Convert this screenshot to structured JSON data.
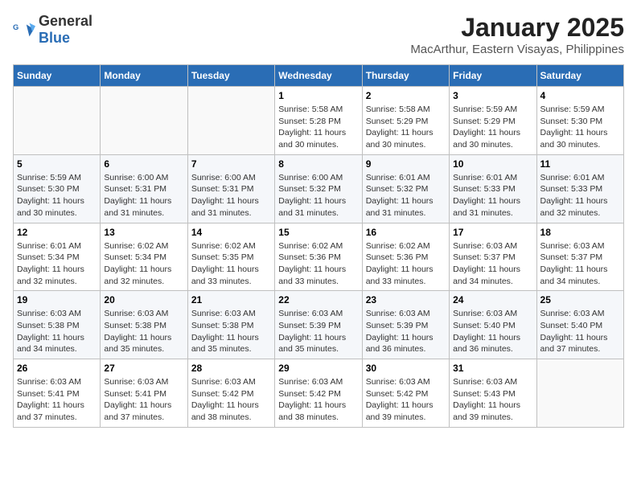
{
  "header": {
    "logo_general": "General",
    "logo_blue": "Blue",
    "month": "January 2025",
    "location": "MacArthur, Eastern Visayas, Philippines"
  },
  "weekdays": [
    "Sunday",
    "Monday",
    "Tuesday",
    "Wednesday",
    "Thursday",
    "Friday",
    "Saturday"
  ],
  "weeks": [
    [
      {
        "day": "",
        "sunrise": "",
        "sunset": "",
        "daylight": ""
      },
      {
        "day": "",
        "sunrise": "",
        "sunset": "",
        "daylight": ""
      },
      {
        "day": "",
        "sunrise": "",
        "sunset": "",
        "daylight": ""
      },
      {
        "day": "1",
        "sunrise": "Sunrise: 5:58 AM",
        "sunset": "Sunset: 5:28 PM",
        "daylight": "Daylight: 11 hours and 30 minutes."
      },
      {
        "day": "2",
        "sunrise": "Sunrise: 5:58 AM",
        "sunset": "Sunset: 5:29 PM",
        "daylight": "Daylight: 11 hours and 30 minutes."
      },
      {
        "day": "3",
        "sunrise": "Sunrise: 5:59 AM",
        "sunset": "Sunset: 5:29 PM",
        "daylight": "Daylight: 11 hours and 30 minutes."
      },
      {
        "day": "4",
        "sunrise": "Sunrise: 5:59 AM",
        "sunset": "Sunset: 5:30 PM",
        "daylight": "Daylight: 11 hours and 30 minutes."
      }
    ],
    [
      {
        "day": "5",
        "sunrise": "Sunrise: 5:59 AM",
        "sunset": "Sunset: 5:30 PM",
        "daylight": "Daylight: 11 hours and 30 minutes."
      },
      {
        "day": "6",
        "sunrise": "Sunrise: 6:00 AM",
        "sunset": "Sunset: 5:31 PM",
        "daylight": "Daylight: 11 hours and 31 minutes."
      },
      {
        "day": "7",
        "sunrise": "Sunrise: 6:00 AM",
        "sunset": "Sunset: 5:31 PM",
        "daylight": "Daylight: 11 hours and 31 minutes."
      },
      {
        "day": "8",
        "sunrise": "Sunrise: 6:00 AM",
        "sunset": "Sunset: 5:32 PM",
        "daylight": "Daylight: 11 hours and 31 minutes."
      },
      {
        "day": "9",
        "sunrise": "Sunrise: 6:01 AM",
        "sunset": "Sunset: 5:32 PM",
        "daylight": "Daylight: 11 hours and 31 minutes."
      },
      {
        "day": "10",
        "sunrise": "Sunrise: 6:01 AM",
        "sunset": "Sunset: 5:33 PM",
        "daylight": "Daylight: 11 hours and 31 minutes."
      },
      {
        "day": "11",
        "sunrise": "Sunrise: 6:01 AM",
        "sunset": "Sunset: 5:33 PM",
        "daylight": "Daylight: 11 hours and 32 minutes."
      }
    ],
    [
      {
        "day": "12",
        "sunrise": "Sunrise: 6:01 AM",
        "sunset": "Sunset: 5:34 PM",
        "daylight": "Daylight: 11 hours and 32 minutes."
      },
      {
        "day": "13",
        "sunrise": "Sunrise: 6:02 AM",
        "sunset": "Sunset: 5:34 PM",
        "daylight": "Daylight: 11 hours and 32 minutes."
      },
      {
        "day": "14",
        "sunrise": "Sunrise: 6:02 AM",
        "sunset": "Sunset: 5:35 PM",
        "daylight": "Daylight: 11 hours and 33 minutes."
      },
      {
        "day": "15",
        "sunrise": "Sunrise: 6:02 AM",
        "sunset": "Sunset: 5:36 PM",
        "daylight": "Daylight: 11 hours and 33 minutes."
      },
      {
        "day": "16",
        "sunrise": "Sunrise: 6:02 AM",
        "sunset": "Sunset: 5:36 PM",
        "daylight": "Daylight: 11 hours and 33 minutes."
      },
      {
        "day": "17",
        "sunrise": "Sunrise: 6:03 AM",
        "sunset": "Sunset: 5:37 PM",
        "daylight": "Daylight: 11 hours and 34 minutes."
      },
      {
        "day": "18",
        "sunrise": "Sunrise: 6:03 AM",
        "sunset": "Sunset: 5:37 PM",
        "daylight": "Daylight: 11 hours and 34 minutes."
      }
    ],
    [
      {
        "day": "19",
        "sunrise": "Sunrise: 6:03 AM",
        "sunset": "Sunset: 5:38 PM",
        "daylight": "Daylight: 11 hours and 34 minutes."
      },
      {
        "day": "20",
        "sunrise": "Sunrise: 6:03 AM",
        "sunset": "Sunset: 5:38 PM",
        "daylight": "Daylight: 11 hours and 35 minutes."
      },
      {
        "day": "21",
        "sunrise": "Sunrise: 6:03 AM",
        "sunset": "Sunset: 5:38 PM",
        "daylight": "Daylight: 11 hours and 35 minutes."
      },
      {
        "day": "22",
        "sunrise": "Sunrise: 6:03 AM",
        "sunset": "Sunset: 5:39 PM",
        "daylight": "Daylight: 11 hours and 35 minutes."
      },
      {
        "day": "23",
        "sunrise": "Sunrise: 6:03 AM",
        "sunset": "Sunset: 5:39 PM",
        "daylight": "Daylight: 11 hours and 36 minutes."
      },
      {
        "day": "24",
        "sunrise": "Sunrise: 6:03 AM",
        "sunset": "Sunset: 5:40 PM",
        "daylight": "Daylight: 11 hours and 36 minutes."
      },
      {
        "day": "25",
        "sunrise": "Sunrise: 6:03 AM",
        "sunset": "Sunset: 5:40 PM",
        "daylight": "Daylight: 11 hours and 37 minutes."
      }
    ],
    [
      {
        "day": "26",
        "sunrise": "Sunrise: 6:03 AM",
        "sunset": "Sunset: 5:41 PM",
        "daylight": "Daylight: 11 hours and 37 minutes."
      },
      {
        "day": "27",
        "sunrise": "Sunrise: 6:03 AM",
        "sunset": "Sunset: 5:41 PM",
        "daylight": "Daylight: 11 hours and 37 minutes."
      },
      {
        "day": "28",
        "sunrise": "Sunrise: 6:03 AM",
        "sunset": "Sunset: 5:42 PM",
        "daylight": "Daylight: 11 hours and 38 minutes."
      },
      {
        "day": "29",
        "sunrise": "Sunrise: 6:03 AM",
        "sunset": "Sunset: 5:42 PM",
        "daylight": "Daylight: 11 hours and 38 minutes."
      },
      {
        "day": "30",
        "sunrise": "Sunrise: 6:03 AM",
        "sunset": "Sunset: 5:42 PM",
        "daylight": "Daylight: 11 hours and 39 minutes."
      },
      {
        "day": "31",
        "sunrise": "Sunrise: 6:03 AM",
        "sunset": "Sunset: 5:43 PM",
        "daylight": "Daylight: 11 hours and 39 minutes."
      },
      {
        "day": "",
        "sunrise": "",
        "sunset": "",
        "daylight": ""
      }
    ]
  ]
}
